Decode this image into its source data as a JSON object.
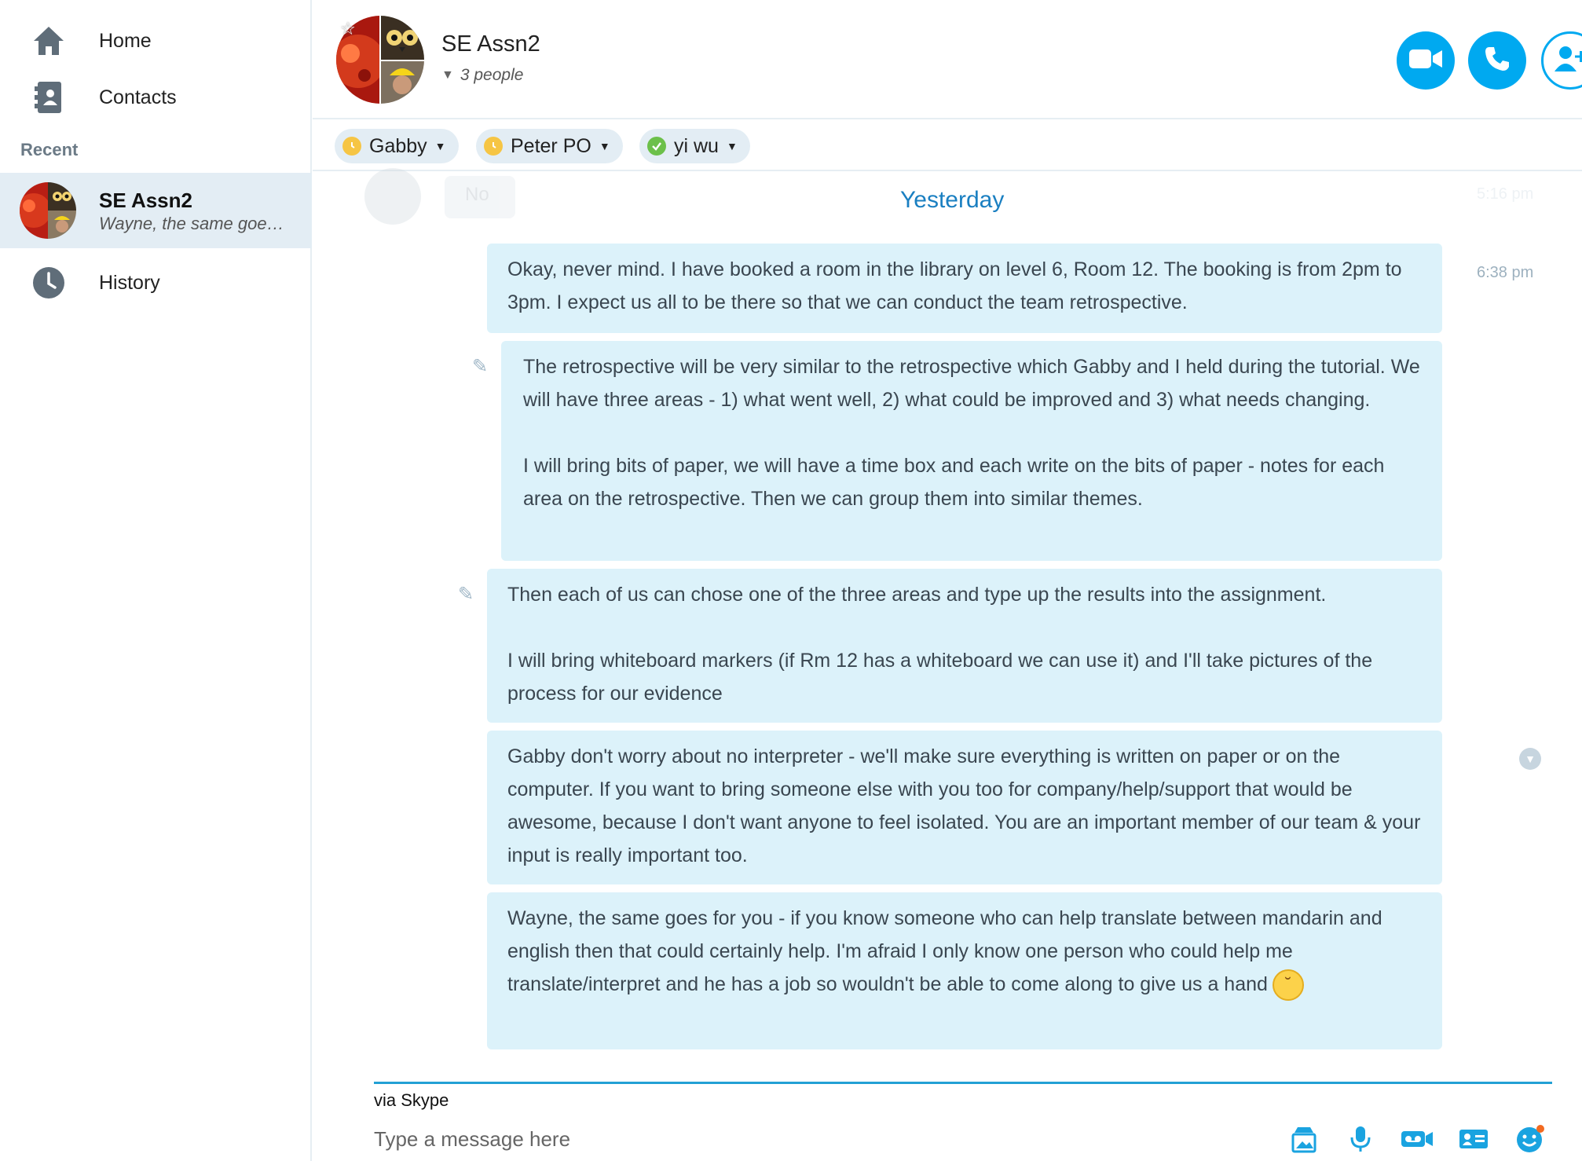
{
  "sidebar": {
    "home_label": "Home",
    "contacts_label": "Contacts",
    "recent_heading": "Recent",
    "recent_item": {
      "title": "SE Assn2",
      "preview": "Wayne, the same goe…"
    },
    "history_label": "History"
  },
  "header": {
    "title": "SE Assn2",
    "people": "3 people",
    "buttons": [
      "video-call-icon",
      "audio-call-icon",
      "add-people-icon"
    ]
  },
  "participants": [
    {
      "name": "Gabby",
      "status": "away",
      "status_color": "#f6c544"
    },
    {
      "name": "Peter PO",
      "status": "away",
      "status_color": "#f6c544"
    },
    {
      "name": "yi wu",
      "status": "online",
      "status_color": "#6cc04a"
    }
  ],
  "conversation": {
    "faded_text": "No",
    "faded_time": "5:16 pm",
    "date_separator": "Yesterday",
    "time": "6:38 pm",
    "messages": [
      {
        "text": "Okay, never mind. I have booked a room in the library on level 6, Room 12. The booking is from 2pm to 3pm. I expect us all to be there so that we can conduct the team retrospective."
      },
      {
        "paragraphs": [
          "The retrospective will be very similar to the retrospective which Gabby and I held during the tutorial. We will have three areas - 1) what went well, 2) what could be improved and 3) what needs changing.",
          "I will bring bits of paper, we will have a time box and each write on the bits of paper - notes for each area on the retrospective. Then we can group them into similar themes."
        ]
      },
      {
        "paragraphs": [
          "Then each of us can chose one of the three areas and type up the results into the assignment.",
          "I will bring whiteboard markers (if Rm 12 has a whiteboard we can use it) and I'll  take pictures of the process for our evidence"
        ]
      },
      {
        "text": "Gabby don't worry about no interpreter - we'll make sure everything is written on paper or on the computer. If you want to bring someone else with you too for company/help/support that would be awesome, because I don't want anyone to feel isolated. You are an important member of our team & your input is really important too."
      },
      {
        "text": "Wayne, the same goes for you - if you know someone who can help translate between mandarin and english then that could certainly help. I'm afraid I only know one person who could help me translate/interpret and he has a job so wouldn't be able to come along to give us a hand"
      }
    ]
  },
  "compose": {
    "via": "via Skype",
    "placeholder": "Type a message here",
    "tools": [
      "send-image-icon",
      "microphone-icon",
      "video-message-icon",
      "contact-card-icon",
      "emoticon-icon"
    ]
  },
  "colors": {
    "accent": "#00a9f0",
    "bubble": "#dcf2fa",
    "sidebar_selected": "#e3edf4",
    "date_separator": "#1a7fc1"
  }
}
